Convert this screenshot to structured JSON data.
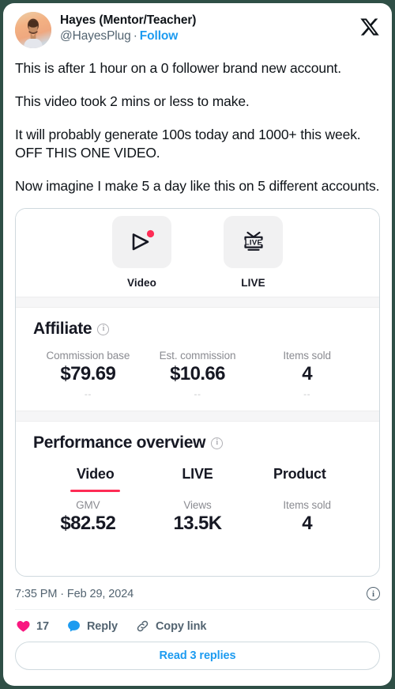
{
  "theme": {
    "page_background": "#2f4f46",
    "card_background": "#ffffff",
    "link_blue": "#1d9bf0",
    "muted_gray": "#536471",
    "tiktok_red": "#fe2c55",
    "heart_pink": "#f91880"
  },
  "author": {
    "display_name": "Hayes (Mentor/Teacher)",
    "handle": "@HayesPlug",
    "separator": "·",
    "follow_label": "Follow",
    "avatar_alt": "avatar"
  },
  "brand": {
    "logo_name": "x-logo"
  },
  "tweet": {
    "paragraphs": [
      "This is after 1 hour on a 0 follower brand new account.",
      "This video took 2 mins or less to make.",
      "It will probably generate 100s today and 1000+ this week. OFF THIS ONE VIDEO.",
      "Now imagine I make 5 a day like this on 5 different accounts."
    ]
  },
  "media_card": {
    "creator_tabs": [
      {
        "label": "Video",
        "icon": "video-play-icon"
      },
      {
        "label": "LIVE",
        "icon": "live-tv-icon"
      }
    ],
    "affiliate": {
      "title": "Affiliate",
      "info_icon": "info-icon",
      "stats": [
        {
          "label": "Commission base",
          "value": "$79.69",
          "sub": "--"
        },
        {
          "label": "Est. commission",
          "value": "$10.66",
          "sub": "--"
        },
        {
          "label": "Items sold",
          "value": "4",
          "sub": "--"
        }
      ]
    },
    "performance": {
      "title": "Performance overview",
      "info_icon": "info-icon",
      "tabs": [
        {
          "label": "Video",
          "active": true
        },
        {
          "label": "LIVE",
          "active": false
        },
        {
          "label": "Product",
          "active": false
        }
      ],
      "stats": [
        {
          "label": "GMV",
          "value": "$82.52"
        },
        {
          "label": "Views",
          "value": "13.5K"
        },
        {
          "label": "Items sold",
          "value": "4"
        }
      ]
    }
  },
  "footer": {
    "timestamp": "7:35 PM · Feb 29, 2024",
    "info_icon": "info-icon",
    "actions": [
      {
        "name": "like",
        "label": "17",
        "icon": "heart-icon"
      },
      {
        "name": "reply",
        "label": "Reply",
        "icon": "speech-bubble-icon"
      },
      {
        "name": "copy-link",
        "label": "Copy link",
        "icon": "link-icon"
      }
    ],
    "read_replies_label": "Read 3 replies"
  }
}
